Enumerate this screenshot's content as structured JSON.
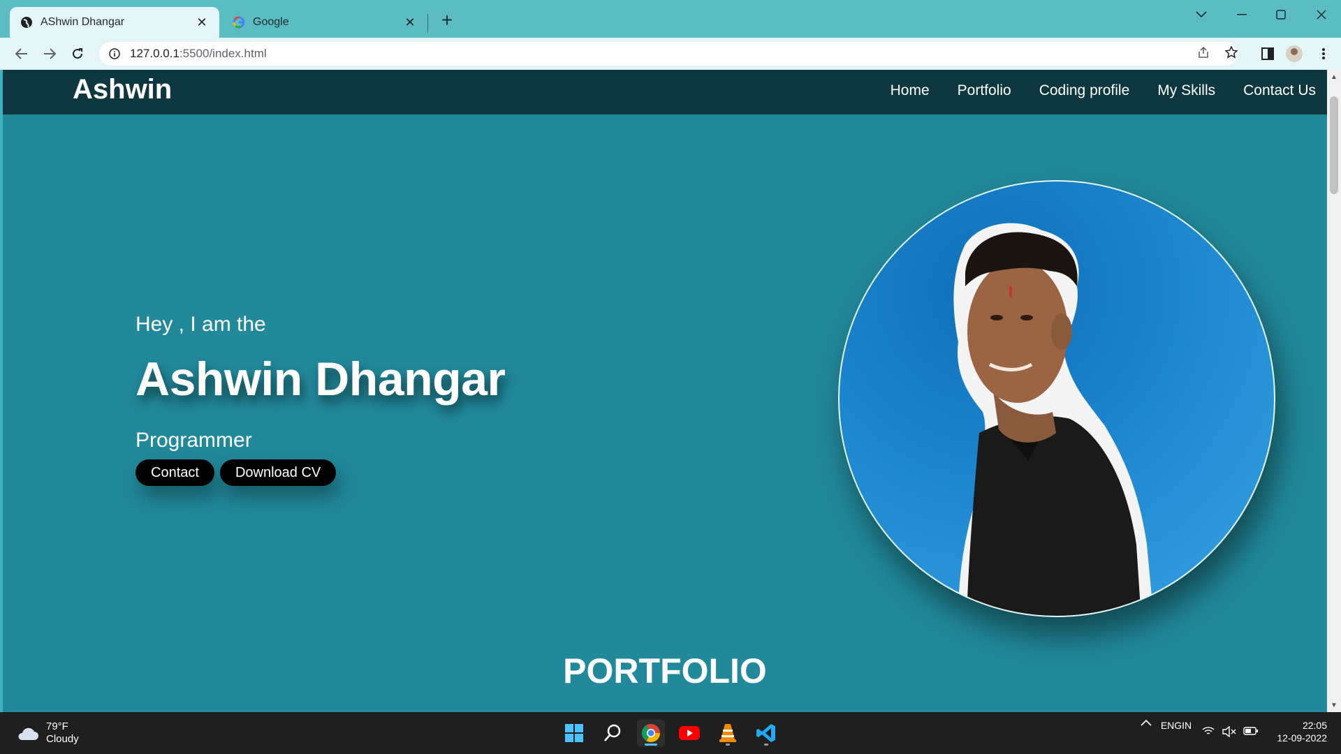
{
  "browser": {
    "tabs": [
      {
        "title": "AShwin Dhangar",
        "active": true
      },
      {
        "title": "Google",
        "active": false
      }
    ],
    "url_host": "127.0.0.1",
    "url_path": ":5500/index.html"
  },
  "site": {
    "logo": "Ashwin",
    "nav": [
      "Home",
      "Portfolio",
      "Coding profile",
      "My Skills",
      "Contact Us"
    ],
    "hero": {
      "greeting": "Hey , I am the",
      "name": "Ashwin Dhangar",
      "role": "Programmer",
      "buttons": [
        "Contact",
        "Download CV"
      ]
    },
    "section_title": "PORTFOLIO",
    "colors": {
      "nav_bg": "#0e3740",
      "page_bg": "#21899a",
      "button_bg": "#000000"
    }
  },
  "taskbar": {
    "weather": {
      "temp": "79°F",
      "condition": "Cloudy"
    },
    "apps": [
      "windows-start-icon",
      "search-icon",
      "chrome-icon",
      "youtube-icon",
      "vlc-icon",
      "vscode-icon"
    ],
    "language": {
      "lang": "ENG",
      "region": "IN"
    },
    "time": "22:05",
    "date": "12-09-2022"
  }
}
